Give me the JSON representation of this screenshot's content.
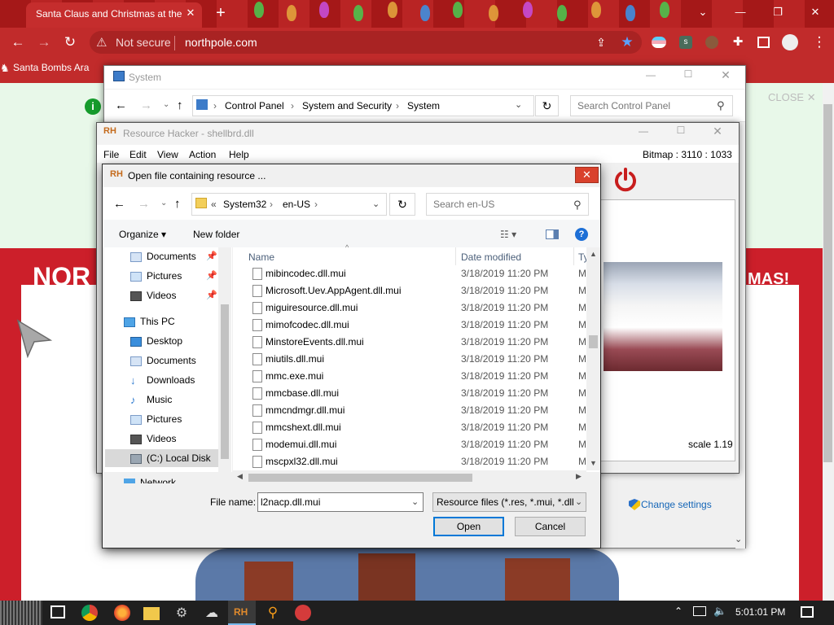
{
  "browser": {
    "tab_title": "Santa Claus and Christmas at the",
    "tab_close": "✕",
    "new_tab": "+",
    "security": "Not secure",
    "url": "northpole.com",
    "bookmark": "Santa Bombs Ara"
  },
  "page": {
    "banner_left": "NOR",
    "banner_right": "MAS!",
    "close_label": "CLOSE"
  },
  "system_window": {
    "title": "System",
    "breadcrumbs": [
      "Control Panel",
      "System and Security",
      "System"
    ],
    "search_placeholder": "Search Control Panel",
    "change_settings": "Change settings"
  },
  "resource_hacker": {
    "title": "Resource Hacker - shellbrd.dll",
    "menu": [
      "File",
      "Edit",
      "View",
      "Action",
      "Help"
    ],
    "bitmap_info": "Bitmap : 3110 : 1033",
    "scale": "scale 1.19"
  },
  "dialog": {
    "title": "Open file containing resource ...",
    "path": [
      "«",
      "System32",
      "en-US"
    ],
    "search_placeholder": "Search en-US",
    "organize": "Organize",
    "new_folder": "New folder",
    "help": "?",
    "nav_items": [
      {
        "label": "Documents",
        "pinned": true
      },
      {
        "label": "Pictures",
        "pinned": true
      },
      {
        "label": "Videos",
        "pinned": true
      },
      {
        "label": "This PC"
      },
      {
        "label": "Desktop"
      },
      {
        "label": "Documents"
      },
      {
        "label": "Downloads"
      },
      {
        "label": "Music"
      },
      {
        "label": "Pictures"
      },
      {
        "label": "Videos"
      },
      {
        "label": "(C:) Local Disk"
      },
      {
        "label": "Network"
      }
    ],
    "columns": [
      "Name",
      "Date modified",
      "Ty"
    ],
    "files": [
      {
        "name": "mibincodec.dll.mui",
        "date": "3/18/2019 11:20 PM",
        "type": "M"
      },
      {
        "name": "Microsoft.Uev.AppAgent.dll.mui",
        "date": "3/18/2019 11:20 PM",
        "type": "M"
      },
      {
        "name": "miguiresource.dll.mui",
        "date": "3/18/2019 11:20 PM",
        "type": "M"
      },
      {
        "name": "mimofcodec.dll.mui",
        "date": "3/18/2019 11:20 PM",
        "type": "M"
      },
      {
        "name": "MinstoreEvents.dll.mui",
        "date": "3/18/2019 11:20 PM",
        "type": "M"
      },
      {
        "name": "miutils.dll.mui",
        "date": "3/18/2019 11:20 PM",
        "type": "M"
      },
      {
        "name": "mmc.exe.mui",
        "date": "3/18/2019 11:20 PM",
        "type": "M"
      },
      {
        "name": "mmcbase.dll.mui",
        "date": "3/18/2019 11:20 PM",
        "type": "M"
      },
      {
        "name": "mmcndmgr.dll.mui",
        "date": "3/18/2019 11:20 PM",
        "type": "M"
      },
      {
        "name": "mmcshext.dll.mui",
        "date": "3/18/2019 11:20 PM",
        "type": "M"
      },
      {
        "name": "modemui.dll.mui",
        "date": "3/18/2019 11:20 PM",
        "type": "M"
      },
      {
        "name": "mscpxl32.dll.mui",
        "date": "3/18/2019 11:20 PM",
        "type": "M"
      }
    ],
    "file_name_label": "File name:",
    "file_name_value": "l2nacp.dll.mui",
    "file_type": "Resource files (*.res, *.mui, *.dll",
    "open": "Open",
    "cancel": "Cancel"
  },
  "taskbar": {
    "clock": "5:01:01 PM"
  },
  "colors": {
    "chrome_red": "#c12b2b",
    "page_red": "#cc1f2a",
    "accent_blue": "#0078d7",
    "close_red": "#d9412c"
  }
}
